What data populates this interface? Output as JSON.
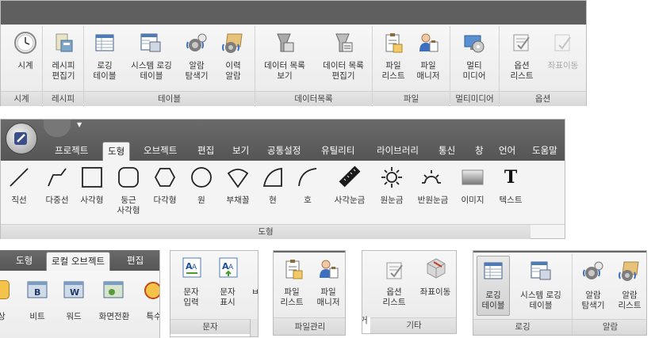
{
  "panel1": {
    "items": [
      {
        "label": "시계",
        "icon": "clock-icon"
      },
      {
        "label": "레시피\n편집기",
        "icon": "recipe-icon"
      },
      {
        "label": "로깅\n테이블",
        "icon": "logging-table-icon"
      },
      {
        "label": "시스템 로깅\n테이블",
        "icon": "system-logging-icon"
      },
      {
        "label": "알람\n탐색기",
        "icon": "alarm-explorer-icon"
      },
      {
        "label": "이력\n알람",
        "icon": "alarm-history-icon"
      },
      {
        "label": "데이터 목록\n보기",
        "icon": "data-list-view-icon"
      },
      {
        "label": "데이터 목록\n편집기",
        "icon": "data-list-editor-icon"
      },
      {
        "label": "파일\n리스트",
        "icon": "file-list-icon"
      },
      {
        "label": "파일\n매니저",
        "icon": "file-manager-icon"
      },
      {
        "label": "멀티\n미디어",
        "icon": "multimedia-icon"
      },
      {
        "label": "옵션\n리스트",
        "icon": "option-list-icon"
      },
      {
        "label": "좌표이동",
        "icon": "coordinate-move-icon"
      }
    ],
    "groups": [
      "시계",
      "레시피",
      "테이블",
      "데이터목록",
      "파일",
      "멀티미디어",
      "옵션"
    ]
  },
  "panel2": {
    "menu": [
      "프로젝트",
      "도형",
      "오브젝트",
      "편집",
      "보기",
      "공통설정",
      "유틸리티",
      "라이브러리",
      "통신",
      "창",
      "언어",
      "도움말"
    ],
    "quick_access": "▼",
    "tools": [
      {
        "label": "직선",
        "icon": "line-icon"
      },
      {
        "label": "다중선",
        "icon": "polyline-icon"
      },
      {
        "label": "사각형",
        "icon": "rectangle-icon"
      },
      {
        "label": "둥근\n사각형",
        "icon": "rounded-rect-icon"
      },
      {
        "label": "다각형",
        "icon": "polygon-icon"
      },
      {
        "label": "원",
        "icon": "circle-icon"
      },
      {
        "label": "부채꼴",
        "icon": "sector-icon"
      },
      {
        "label": "현",
        "icon": "chord-icon"
      },
      {
        "label": "호",
        "icon": "arc-icon"
      },
      {
        "label": "사각눈금",
        "icon": "rect-scale-icon"
      },
      {
        "label": "원눈금",
        "icon": "circle-scale-icon"
      },
      {
        "label": "반원눈금",
        "icon": "semicircle-scale-icon"
      },
      {
        "label": "이미지",
        "icon": "image-icon"
      },
      {
        "label": "텍스트",
        "icon": "text-icon"
      }
    ],
    "group": "도형"
  },
  "panel3": {
    "tabs": [
      "도형",
      "로컬 오브젝트",
      "편집"
    ],
    "items": [
      "비트",
      "워드",
      "화면전환",
      "특수"
    ]
  },
  "panel4": {
    "items": [
      {
        "label": "문자\n입력",
        "icon": "text-input-icon"
      },
      {
        "label": "문자\n표시",
        "icon": "text-display-icon"
      }
    ],
    "group": "문자"
  },
  "panel5": {
    "items": [
      {
        "label": "파일\n리스트",
        "icon": "file-list-icon"
      },
      {
        "label": "파일\n매니저",
        "icon": "file-manager-icon"
      }
    ],
    "group": "파일관리"
  },
  "panel6": {
    "items": [
      {
        "label": "옵션\n리스트",
        "icon": "option-list-icon"
      },
      {
        "label": "좌표이동",
        "icon": "coordinate-move-icon"
      }
    ],
    "group": "기타"
  },
  "panel7": {
    "items": [
      {
        "label": "로깅\n테이블",
        "icon": "logging-table-icon"
      },
      {
        "label": "시스템 로깅\n테이블",
        "icon": "system-logging-icon"
      },
      {
        "label": "알람\n탐색기",
        "icon": "alarm-explorer-icon"
      },
      {
        "label": "알람\n리스트",
        "icon": "alarm-list-icon"
      }
    ],
    "groups": [
      "로깅",
      "알람"
    ]
  }
}
